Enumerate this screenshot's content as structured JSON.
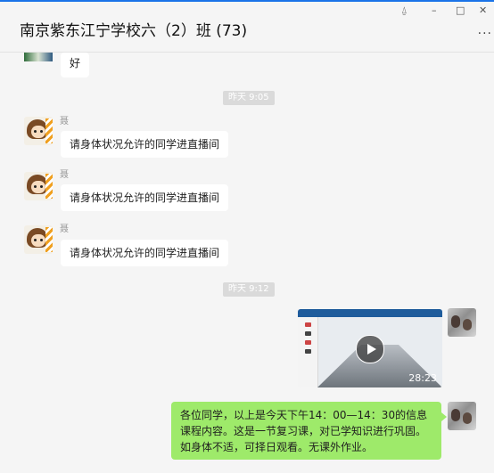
{
  "window": {
    "title": "南京紫东江宁学校六（2）班 (73)",
    "pin_glyph": "⍙",
    "minimize_glyph": "–",
    "maximize_glyph": "□",
    "close_glyph": "✕",
    "more_glyph": "..."
  },
  "messages": {
    "first_bubble": "好",
    "time1": "昨天 9:05",
    "group1": [
      {
        "sender": "聂",
        "text": "请身体状况允许的同学进直播间"
      },
      {
        "sender": "聂",
        "text": "请身体状况允许的同学进直播间"
      },
      {
        "sender": "聂",
        "text": "请身体状况允许的同学进直播间"
      }
    ],
    "time2": "昨天 9:12",
    "video": {
      "duration": "28:23"
    },
    "outgoing": "各位同学，以上是今天下午14：00—14：30的信息课程内容。这是一节复习课，对已学知识进行巩固。如身体不适，可择日观看。无课外作业。"
  },
  "colors": {
    "accent": "#1a73e8",
    "own_bubble": "#9eea6a",
    "background": "#f5f5f5"
  }
}
